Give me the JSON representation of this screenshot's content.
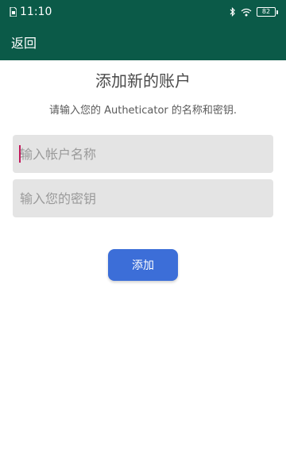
{
  "status_bar": {
    "time": "11:10",
    "battery_level": "82",
    "icons": [
      "sim-icon",
      "bluetooth-icon",
      "wifi-icon",
      "battery-icon"
    ]
  },
  "app_bar": {
    "back_label": "返回"
  },
  "main": {
    "title": "添加新的账户",
    "subtitle": "请输入您的 Autheticator 的名称和密钥.",
    "account_name_field": {
      "placeholder": "输入帐户名称",
      "value": ""
    },
    "secret_field": {
      "placeholder": "输入您的密钥",
      "value": ""
    },
    "add_button_label": "添加"
  },
  "colors": {
    "header_bg": "#0b5a48",
    "button_bg": "#3c6ed8",
    "field_bg": "#e4e4e4",
    "cursor": "#c2185b"
  }
}
